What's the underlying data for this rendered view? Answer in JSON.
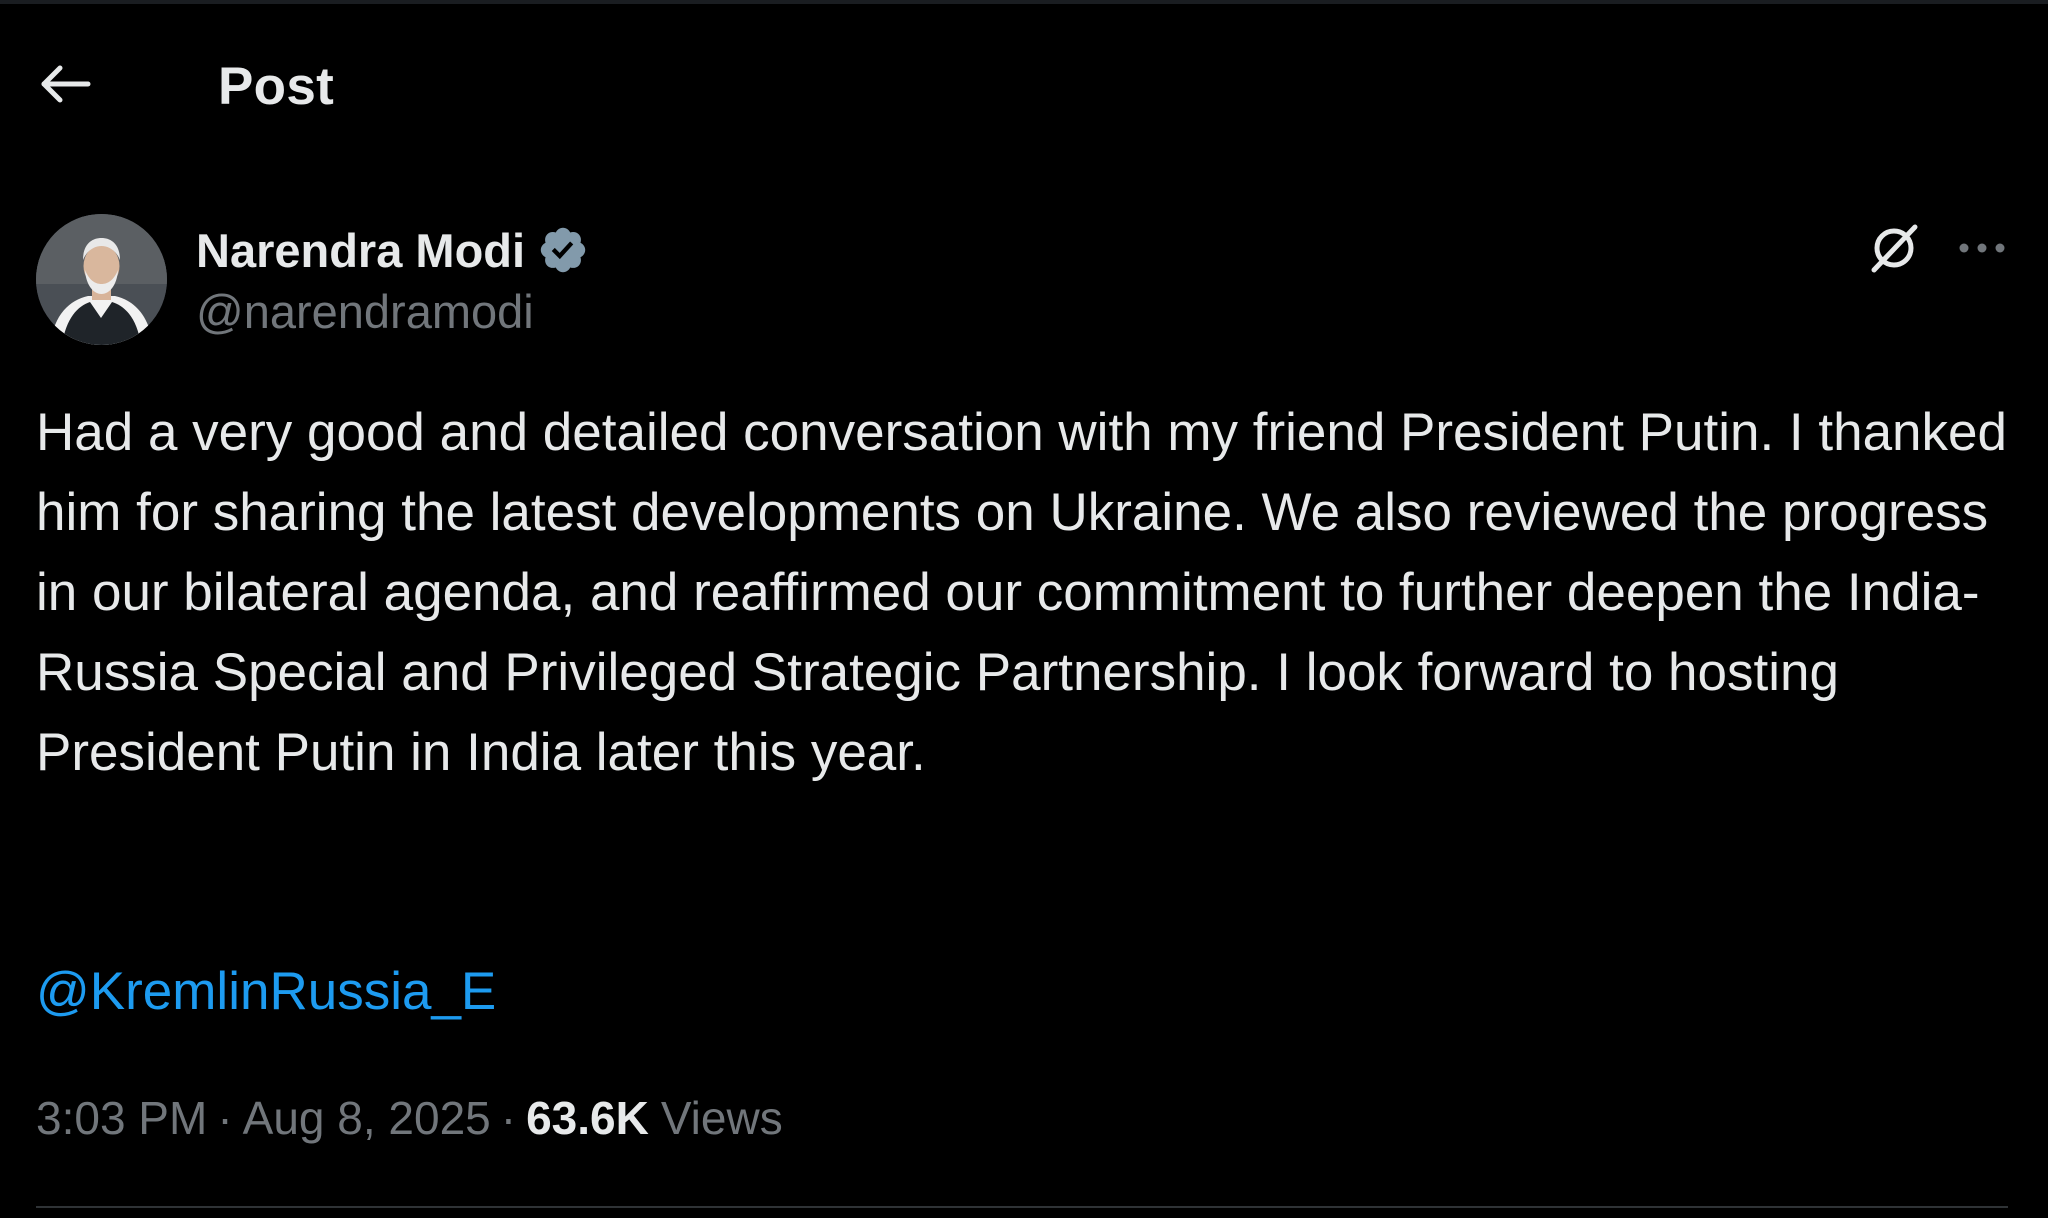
{
  "header": {
    "title": "Post",
    "back_icon": "arrow-left-icon"
  },
  "author": {
    "display_name": "Narendra Modi",
    "handle": "@narendramodi",
    "verified_icon": "verified-badge-icon",
    "verified_color": "#829aab"
  },
  "actions": {
    "grok_icon": "grok-icon",
    "more_icon": "more-horizontal-icon"
  },
  "post": {
    "text": "Had a very good and detailed conversation with my friend President Putin. I thanked him for sharing the latest developments on Ukraine. We also reviewed the progress in our bilateral agenda, and reaffirmed our commitment to further deepen the India-Russia Special and Privileged Strategic Partnership. I look forward to hosting President Putin in India later this year.",
    "mention": "@KremlinRussia_E"
  },
  "meta": {
    "time": "3:03 PM",
    "separator": "·",
    "date": "Aug 8, 2025",
    "views_count": "63.6K",
    "views_label": "Views"
  },
  "colors": {
    "background": "#000000",
    "text_primary": "#e7e9ea",
    "text_secondary": "#71767b",
    "link": "#1d9bf0",
    "divider": "#2f3336"
  }
}
